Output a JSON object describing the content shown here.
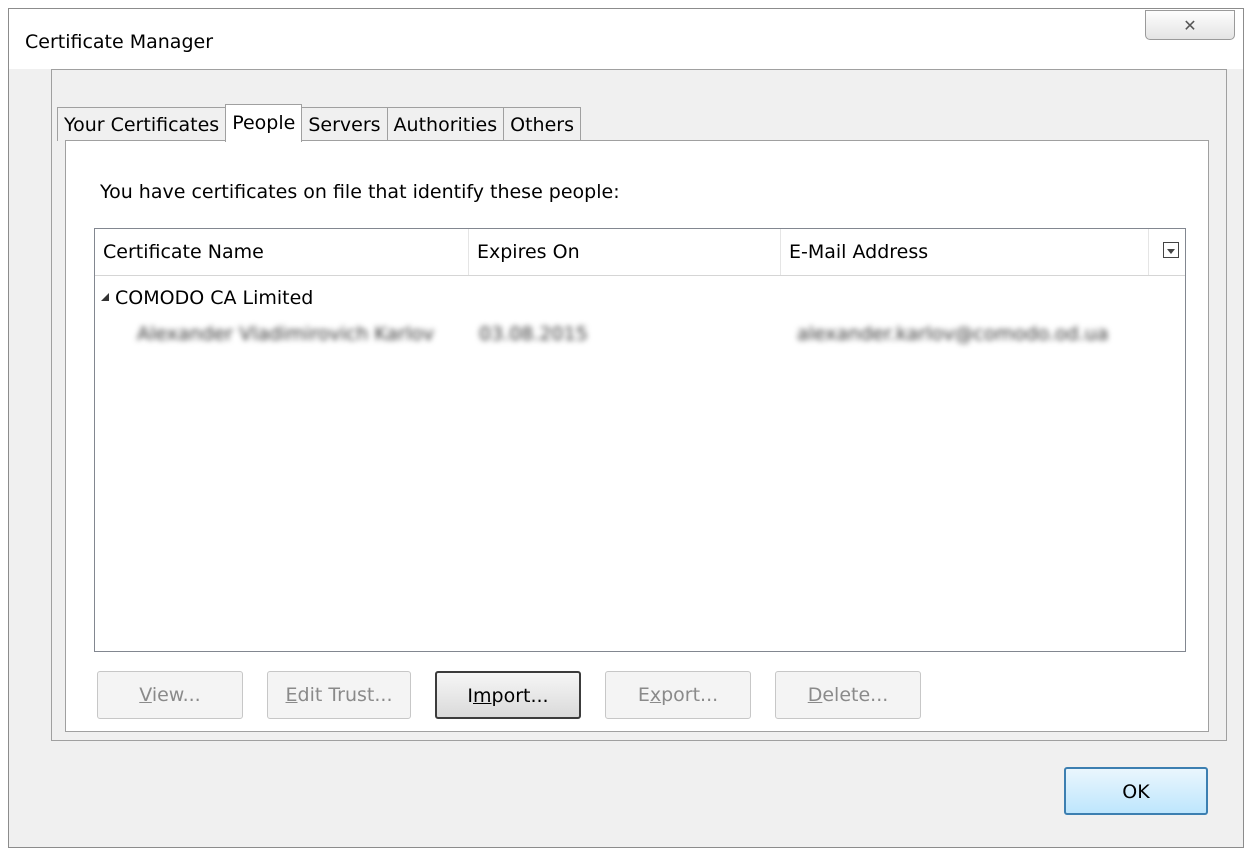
{
  "window": {
    "title": "Certificate Manager",
    "close_glyph": "✕"
  },
  "tabs": [
    {
      "label": "Your Certificates",
      "active": false
    },
    {
      "label": "People",
      "active": true
    },
    {
      "label": "Servers",
      "active": false
    },
    {
      "label": "Authorities",
      "active": false
    },
    {
      "label": "Others",
      "active": false
    }
  ],
  "panel": {
    "intro": "You have certificates on file that identify these people:",
    "columns": [
      "Certificate Name",
      "Expires On",
      "E-Mail Address"
    ],
    "groups": [
      {
        "name": "COMODO CA Limited",
        "rows": [
          {
            "name": "Alexander Vladimirovich Karlov",
            "expires": "03.08.2015",
            "email": "alexander.karlov@comodo.od.ua"
          }
        ]
      }
    ]
  },
  "buttons": {
    "view": {
      "pre": "",
      "accel": "V",
      "post": "iew..."
    },
    "edit_trust": {
      "pre": "",
      "accel": "E",
      "post": "dit Trust..."
    },
    "import": {
      "pre": "I",
      "accel": "m",
      "post": "port..."
    },
    "export": {
      "pre": "E",
      "accel": "x",
      "post": "port..."
    },
    "delete": {
      "pre": "",
      "accel": "D",
      "post": "elete..."
    },
    "ok": "OK"
  }
}
